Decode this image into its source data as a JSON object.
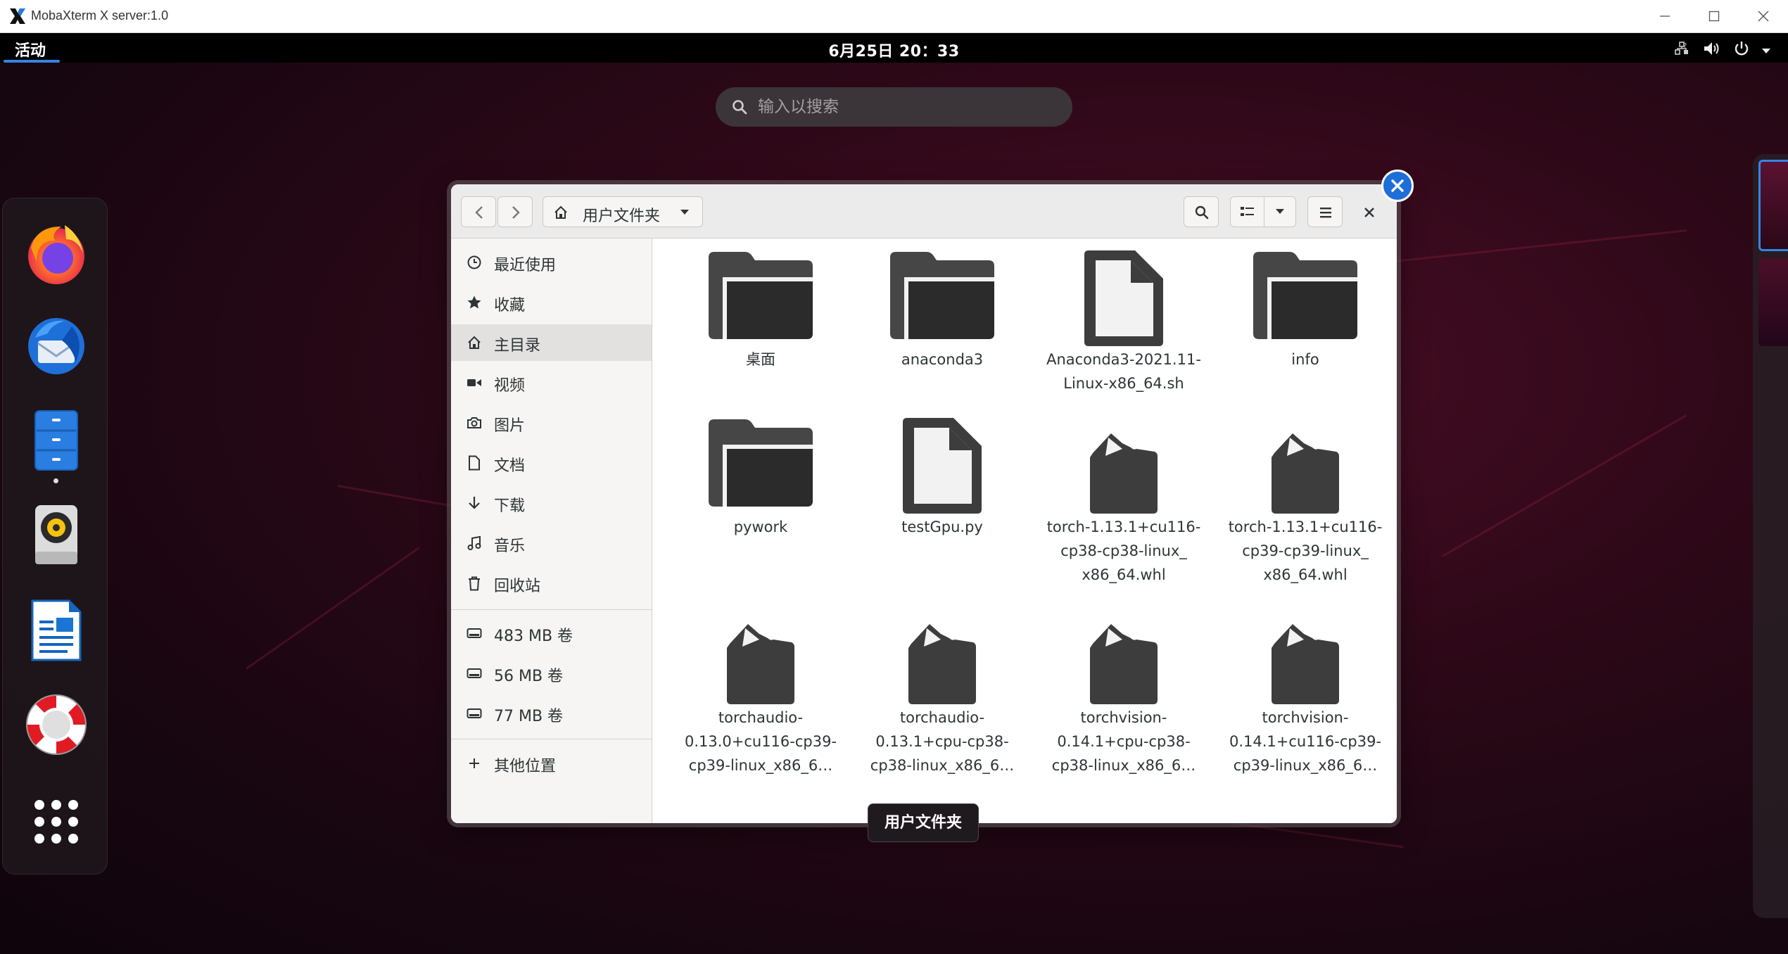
{
  "window": {
    "title": "MobaXterm X server:1.0"
  },
  "topbar": {
    "activities": "活动",
    "clock": "6月25日  20：33"
  },
  "search": {
    "placeholder": "输入以搜索"
  },
  "dock": {
    "items": [
      {
        "name": "firefox-icon"
      },
      {
        "name": "thunderbird-icon"
      },
      {
        "name": "files-icon",
        "running": true
      },
      {
        "name": "rhythmbox-icon"
      },
      {
        "name": "libreoffice-writer-icon"
      },
      {
        "name": "help-icon"
      },
      {
        "name": "show-apps-icon"
      }
    ]
  },
  "files": {
    "path_label": "用户文件夹",
    "sidebar": {
      "places": [
        {
          "label": "最近使用",
          "icon": "clock-icon"
        },
        {
          "label": "收藏",
          "icon": "star-icon"
        },
        {
          "label": "主目录",
          "icon": "home-icon",
          "active": true
        },
        {
          "label": "视频",
          "icon": "video-icon"
        },
        {
          "label": "图片",
          "icon": "camera-icon"
        },
        {
          "label": "文档",
          "icon": "document-icon"
        },
        {
          "label": "下载",
          "icon": "download-icon"
        },
        {
          "label": "音乐",
          "icon": "music-icon"
        },
        {
          "label": "回收站",
          "icon": "trash-icon"
        }
      ],
      "volumes": [
        {
          "label": "483 MB 卷",
          "icon": "drive-icon"
        },
        {
          "label": "56 MB 卷",
          "icon": "drive-icon"
        },
        {
          "label": "77 MB 卷",
          "icon": "drive-icon"
        }
      ],
      "other": {
        "label": "其他位置",
        "icon": "plus-icon"
      }
    },
    "items": [
      {
        "name": "桌面",
        "type": "folder",
        "lines": [
          "桌面"
        ]
      },
      {
        "name": "anaconda3",
        "type": "folder",
        "lines": [
          "anaconda3"
        ]
      },
      {
        "name": "Anaconda3-2021.11-Linux-x86_64.sh",
        "type": "file",
        "lines": [
          "Anaconda3-2021.11-",
          "Linux-x86_64.sh"
        ]
      },
      {
        "name": "info",
        "type": "folder",
        "lines": [
          "info"
        ]
      },
      {
        "name": "pywork",
        "type": "folder",
        "lines": [
          "pywork"
        ]
      },
      {
        "name": "testGpu.py",
        "type": "file",
        "lines": [
          "testGpu.py"
        ]
      },
      {
        "name": "torch-1.13.1+cu116-cp38",
        "type": "package",
        "lines": [
          "torch-1.13.1+cu116-",
          "cp38-cp38-linux_",
          "x86_64.whl"
        ]
      },
      {
        "name": "torch-1.13.1+cu116-cp39",
        "type": "package",
        "lines": [
          "torch-1.13.1+cu116-",
          "cp39-cp39-linux_",
          "x86_64.whl"
        ]
      },
      {
        "name": "torchaudio-0.13.0",
        "type": "package",
        "lines": [
          "torchaudio-",
          "0.13.0+cu116-cp39-",
          "cp39-linux_x86_6…"
        ]
      },
      {
        "name": "torchaudio-0.13.1",
        "type": "package",
        "lines": [
          "torchaudio-",
          "0.13.1+cpu-cp38-",
          "cp38-linux_x86_6…"
        ]
      },
      {
        "name": "torchvision-0.14.1-cpu",
        "type": "package",
        "lines": [
          "torchvision-",
          "0.14.1+cpu-cp38-",
          "cp38-linux_x86_6…"
        ]
      },
      {
        "name": "torchvision-0.14.1-cu116",
        "type": "package",
        "lines": [
          "torchvision-",
          "0.14.1+cu116-cp39-",
          "cp39-linux_x86_6…"
        ]
      }
    ]
  },
  "tooltip": "用户文件夹",
  "colors": {
    "accent": "#3584e4",
    "icon_dark": "#2e3436",
    "close_badge": "#1c6fd6"
  }
}
